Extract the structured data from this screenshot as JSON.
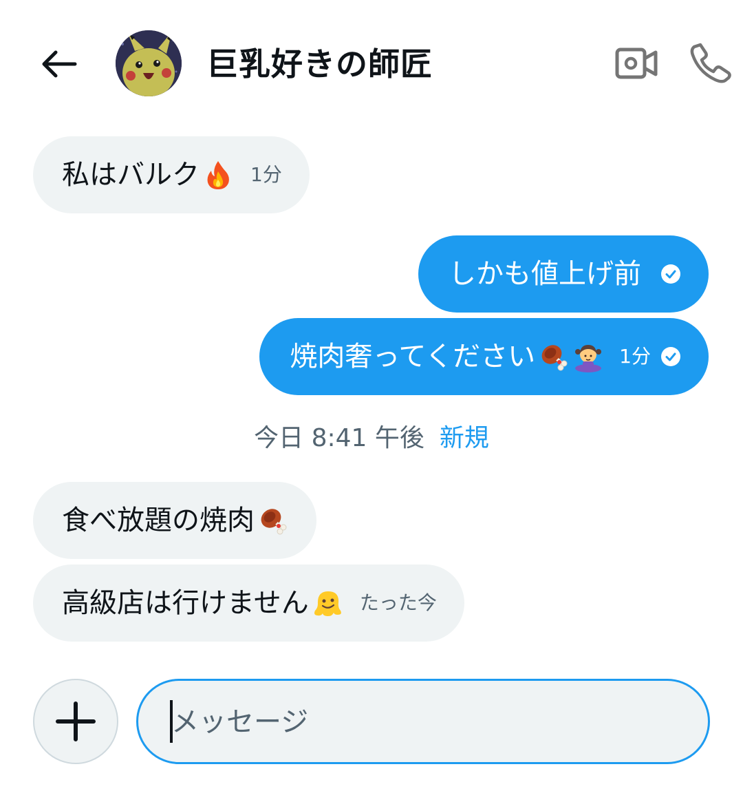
{
  "header": {
    "back_icon": "arrow-left-icon",
    "contact_name": "巨乳好きの師匠",
    "video_icon": "video-camera-icon",
    "call_icon": "phone-icon"
  },
  "messages": [
    {
      "direction": "incoming",
      "text": "私はバルク",
      "emoji": "fire-emoji",
      "time": "1分"
    },
    {
      "direction": "outgoing",
      "text": "しかも値上げ前",
      "read": true
    },
    {
      "direction": "outgoing",
      "text": "焼肉奢ってください",
      "emoji": [
        "meat-on-bone-emoji",
        "person-bowing-emoji"
      ],
      "time": "1分",
      "read": true
    },
    {
      "direction": "incoming",
      "text": "食べ放題の焼肉",
      "emoji": "meat-on-bone-emoji"
    },
    {
      "direction": "incoming",
      "text": "高級店は行けません",
      "emoji": "melting-face-emoji",
      "time": "たった今"
    }
  ],
  "divider": {
    "time": "今日 8:41 午後",
    "new_label": "新規"
  },
  "composer": {
    "plus_icon": "plus-icon",
    "placeholder": "メッセージ",
    "value": ""
  },
  "colors": {
    "accent": "#1d9bf0",
    "incoming_bubble": "#eff3f4",
    "text_primary": "#0f1419",
    "text_secondary": "#536471"
  }
}
